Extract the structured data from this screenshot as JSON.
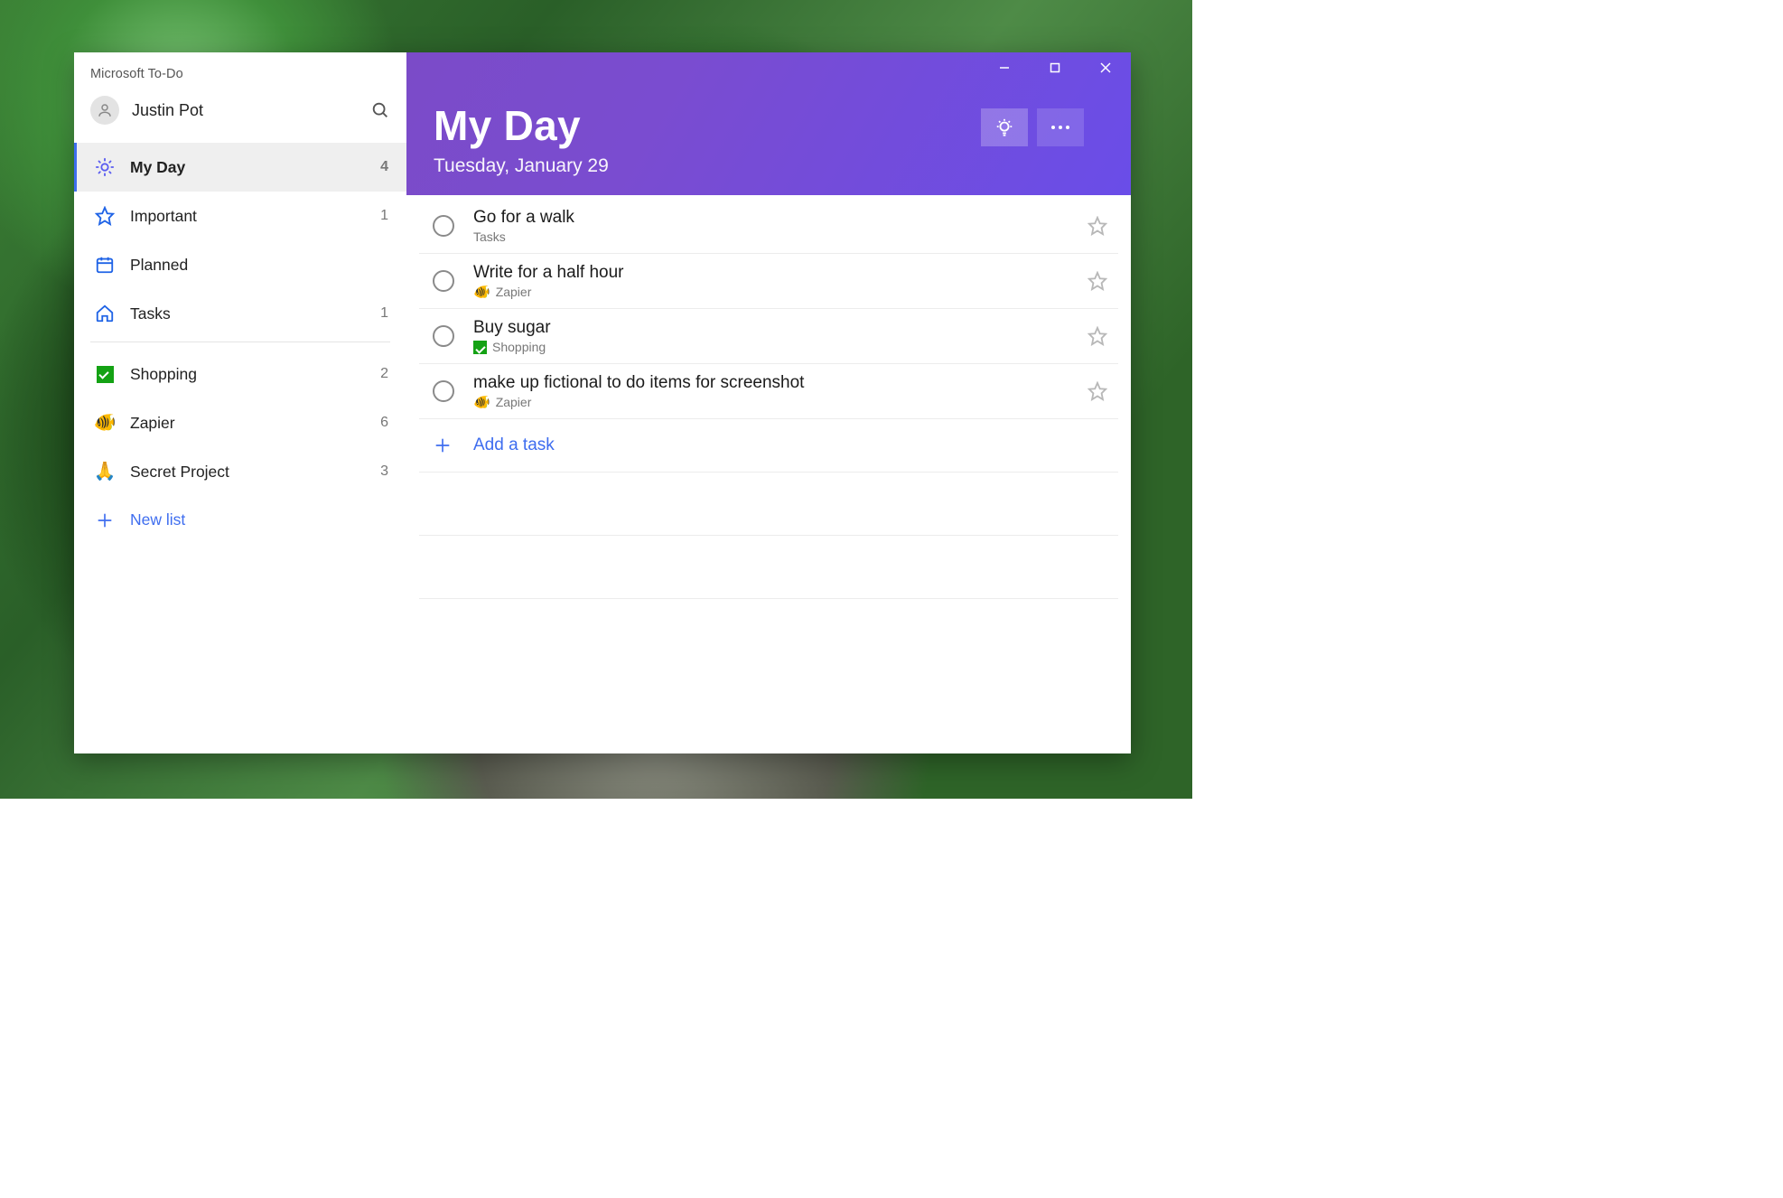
{
  "app_title": "Microsoft To-Do",
  "user": {
    "name": "Justin Pot"
  },
  "sidebar": {
    "smart_lists": [
      {
        "key": "myday",
        "label": "My Day",
        "count": 4,
        "active": true,
        "icon": "sun"
      },
      {
        "key": "important",
        "label": "Important",
        "count": 1,
        "active": false,
        "icon": "star"
      },
      {
        "key": "planned",
        "label": "Planned",
        "count": "",
        "active": false,
        "icon": "calendar"
      },
      {
        "key": "tasks",
        "label": "Tasks",
        "count": 1,
        "active": false,
        "icon": "home"
      }
    ],
    "user_lists": [
      {
        "key": "shopping",
        "label": "Shopping",
        "count": 2,
        "emoji": "✅"
      },
      {
        "key": "zapier",
        "label": "Zapier",
        "count": 6,
        "emoji": "🐠"
      },
      {
        "key": "secret",
        "label": "Secret Project",
        "count": 3,
        "emoji": "🙏"
      }
    ],
    "new_list_label": "New list"
  },
  "header": {
    "title": "My Day",
    "date": "Tuesday, January 29"
  },
  "tasks": [
    {
      "title": "Go for a walk",
      "list": "Tasks",
      "list_emoji": ""
    },
    {
      "title": "Write for a half hour",
      "list": "Zapier",
      "list_emoji": "🐠"
    },
    {
      "title": "Buy sugar",
      "list": "Shopping",
      "list_emoji": "green-check"
    },
    {
      "title": "make up fictional to do items for screenshot",
      "list": "Zapier",
      "list_emoji": "🐠"
    }
  ],
  "add_task_label": "Add a task",
  "colors": {
    "accent": "#3e6def",
    "header_from": "#7b4bc8",
    "header_to": "#6a4de8"
  }
}
